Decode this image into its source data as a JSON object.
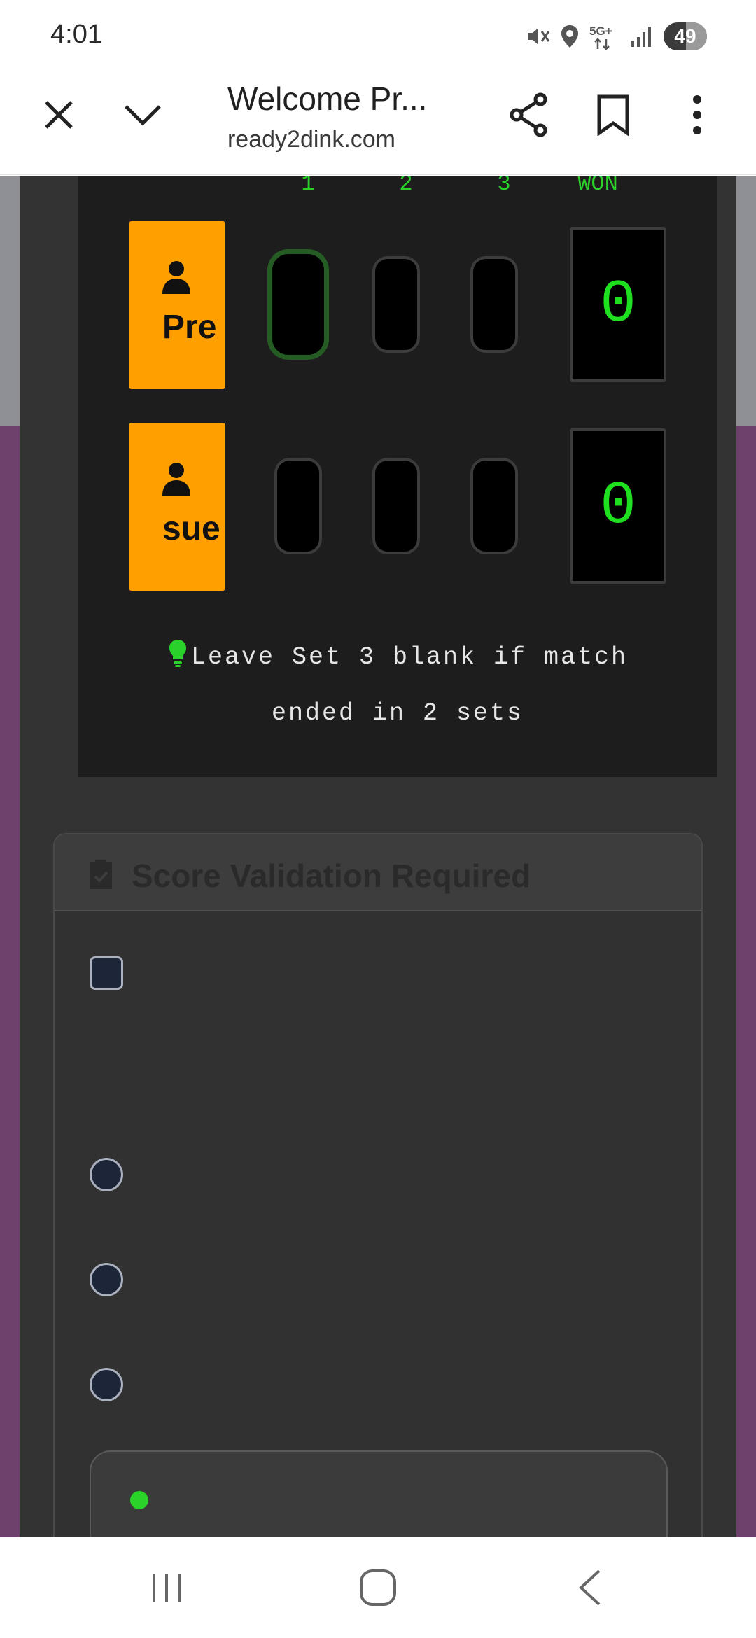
{
  "status_bar": {
    "time": "4:01",
    "battery": "49",
    "icons": [
      "mute-icon",
      "location-icon",
      "5g-icon",
      "signal-icon",
      "battery-icon"
    ]
  },
  "browser": {
    "title": "Welcome Pr...",
    "url": "ready2dink.com",
    "icons": [
      "close-icon",
      "chevron-down-icon",
      "share-icon",
      "bookmark-icon",
      "more-icon"
    ]
  },
  "scoreboard": {
    "columns": [
      "1",
      "2",
      "3",
      "WON"
    ],
    "players": [
      {
        "name": "Pre",
        "won": "0"
      },
      {
        "name": "sue",
        "won": "0"
      }
    ],
    "hint_line1": "Leave Set 3 blank if match",
    "hint_line2": "ended in 2 sets"
  },
  "validation": {
    "title": "Score Validation Required"
  },
  "colors": {
    "accent_green": "#2bd12b",
    "player_tile": "#ff9f00",
    "page_background": "#6e416c"
  }
}
